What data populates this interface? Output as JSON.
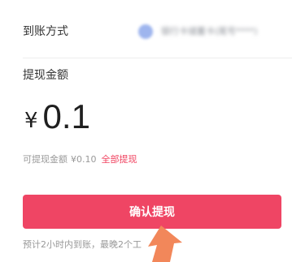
{
  "payout": {
    "method_label": "到账方式",
    "bank_name": "银行卡储蓄卡(尾号****)"
  },
  "amount": {
    "label": "提现金额",
    "currency_symbol": "¥",
    "value": "0.1"
  },
  "available": {
    "label": "可提现金额",
    "value": "¥0.10",
    "withdraw_all_label": "全部提现"
  },
  "confirm_button_label": "确认提现",
  "eta_note": "预计2小时内到账，最晚2个工",
  "colors": {
    "accent": "#ef4564",
    "link": "#f0425f",
    "secondary_text": "#999999",
    "pointer": "#f2875a"
  },
  "icons": {
    "bank": "bank-logo-icon",
    "pointer": "pointer-arrow-icon"
  }
}
